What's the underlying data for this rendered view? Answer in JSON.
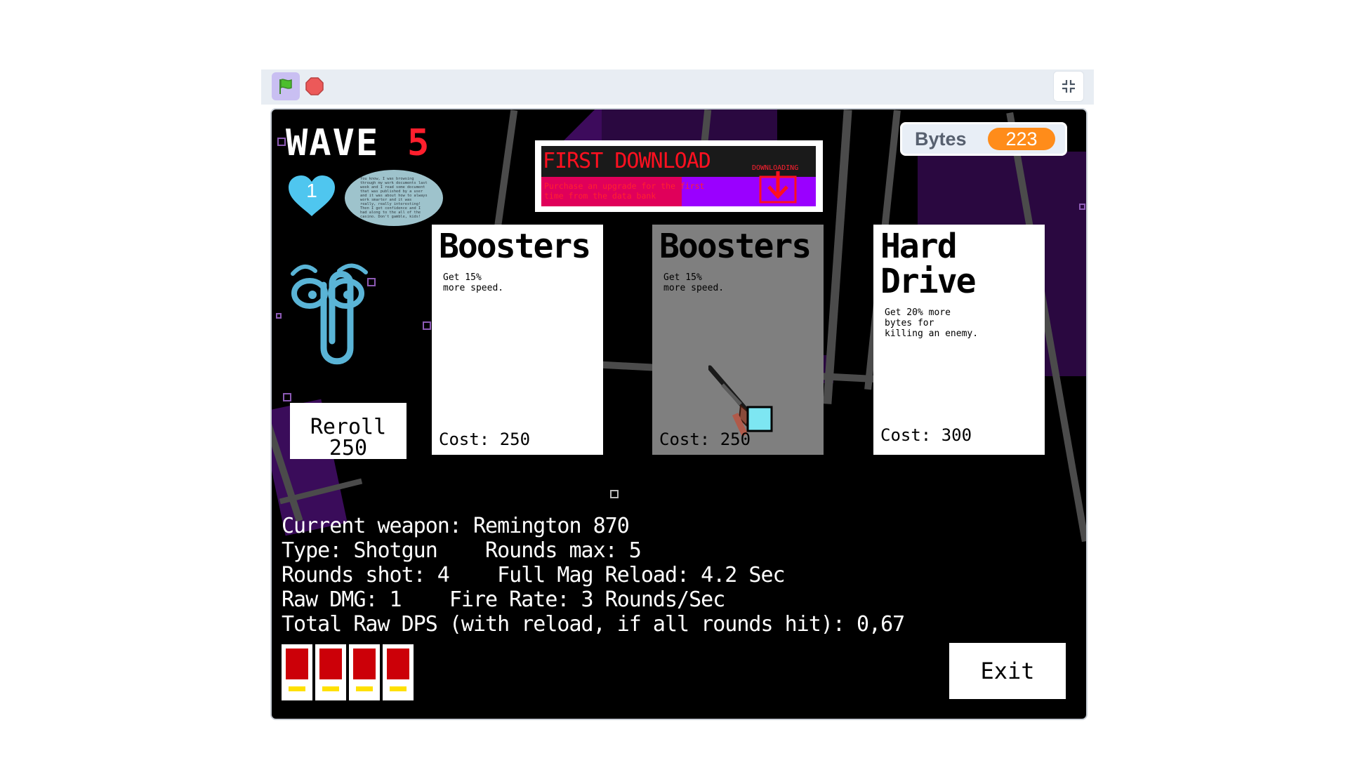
{
  "toolbar": {
    "flag_icon": "green-flag-icon",
    "stop_icon": "stop-icon",
    "fullscreen_icon": "exit-fullscreen-icon"
  },
  "hud": {
    "wave_label": "WAVE",
    "wave_number": "5",
    "lives": "1",
    "speech_bubble": "You know, I was browsing through my work documents last week and I read some document that was published by a user and it was about how to always work smarter and it was really, really interesting! Then I got confidence and I had along to the all of the casino. Don't gamble, kids!"
  },
  "banner": {
    "title": "FIRST DOWNLOAD",
    "description": "Purchase an upgrade for the first time from the data bank",
    "status": "DOWNLOADING"
  },
  "bytes": {
    "label": "Bytes",
    "value": "223"
  },
  "cards": [
    {
      "title": "Boosters",
      "description": "Get 15%\nmore speed.",
      "cost": "Cost: 250"
    },
    {
      "title": "Boosters",
      "description": "Get 15%\nmore speed.",
      "cost": "Cost: 250"
    },
    {
      "title": "Hard\nDrive",
      "description": "Get 20% more\nbytes for\nkilling an enemy.",
      "cost": "Cost: 300"
    }
  ],
  "reroll": {
    "label": "Reroll",
    "cost": "250"
  },
  "stats": {
    "line1": "Current weapon: Remington 870",
    "line2": "Type: Shotgun    Rounds max: 5",
    "line3": "Rounds shot: 4    Full Mag Reload: 4.2 Sec",
    "line4": "Raw DMG: 1    Fire Rate: 3 Rounds/Sec",
    "line5": "Total Raw DPS (with reload, if all rounds hit): 0,67"
  },
  "ammo_count": 4,
  "exit_label": "Exit",
  "colors": {
    "wave_number": "#ff1f2d",
    "bytes_pill": "#ff8c1a",
    "heart": "#4fc6ef",
    "banner_purple": "#9a00ff"
  }
}
